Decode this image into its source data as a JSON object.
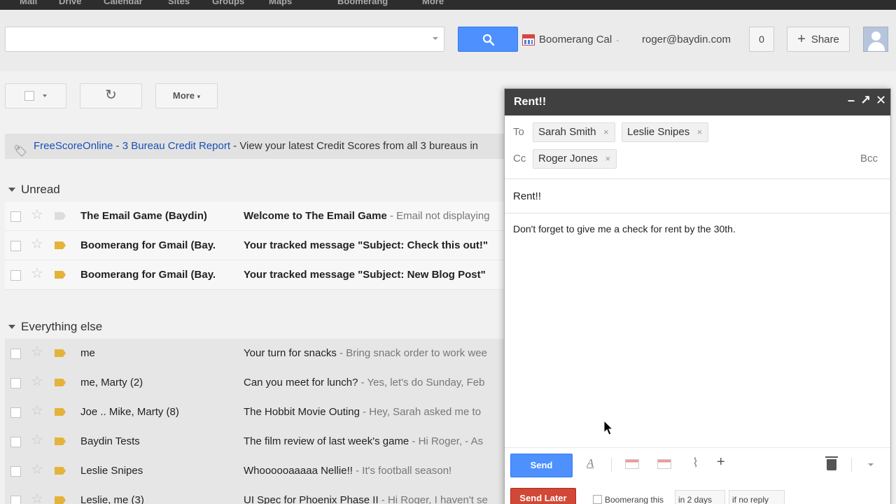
{
  "topnav": [
    "Mail",
    "Drive",
    "Calendar",
    "Sites",
    "Groups",
    "Maps",
    "Boomerang",
    "More"
  ],
  "header": {
    "search_placeholder": "",
    "boomerang_cal": "Boomerang Cal",
    "user_email": "roger@baydin.com",
    "notification_count": "0",
    "share_label": "Share"
  },
  "toolbar": {
    "refresh_icon": "↻",
    "more_label": "More"
  },
  "ad": {
    "sponsor": "FreeScoreOnline",
    "separator": " - ",
    "title": "3 Bureau Credit Report",
    "text": " - View your latest Credit Scores from all 3 bureaus in"
  },
  "sections": {
    "unread": "Unread",
    "everything_else": "Everything else"
  },
  "unread_emails": [
    {
      "sender": "The Email Game (Baydin)",
      "subject": "Welcome to The Email Game",
      "snippet": " - Email not displaying"
    },
    {
      "sender": "Boomerang for Gmail (Bay.",
      "subject": "Your tracked message \"Subject: Check this out!\"",
      "snippet": ""
    },
    {
      "sender": "Boomerang for Gmail (Bay.",
      "subject": "Your tracked message \"Subject: New Blog Post\"",
      "snippet": ""
    }
  ],
  "other_emails": [
    {
      "sender": "me",
      "subject": "Your turn for snacks",
      "snippet": " - Bring snack order to work wee"
    },
    {
      "sender": "me, Marty (2)",
      "subject": "Can you meet for lunch?",
      "snippet": " - Yes, let's do Sunday, Feb"
    },
    {
      "sender": "Joe .. Mike, Marty (8)",
      "subject": "The Hobbit Movie Outing",
      "snippet": " - Hey, Sarah asked me to"
    },
    {
      "sender": "Baydin Tests",
      "subject": "The film review of last week's game",
      "snippet": " - Hi Roger, - As"
    },
    {
      "sender": "Leslie Snipes",
      "subject": "Whoooooaaaaa Nellie!!",
      "snippet": " - It's football season!"
    },
    {
      "sender": "Leslie, me (3)",
      "subject": "UI Spec for Phoenix Phase II",
      "snippet": " - Hi Roger, I haven't se"
    }
  ],
  "compose": {
    "title": "Rent!!",
    "minimize": "–",
    "popout": "↗",
    "close": "✕",
    "to_label": "To",
    "to": [
      "Sarah Smith",
      "Leslie Snipes"
    ],
    "cc_label": "Cc",
    "cc": [
      "Roger Jones"
    ],
    "bcc_label": "Bcc",
    "chip_remove": "×",
    "subject": "Rent!!",
    "body": "Don't forget to give me a check for rent by the 30th.",
    "send_label": "Send",
    "format_icon": "A",
    "plus_icon": "+",
    "send_later_label": "Send Later",
    "boomerang_this": "Boomerang this",
    "when": "in 2 days",
    "condition": "if no reply"
  },
  "colors": {
    "primary_blue": "#4d90fe",
    "send_later_red": "#d14836",
    "label_yellow": "#e3b33a",
    "compose_title_bg": "#404040"
  }
}
